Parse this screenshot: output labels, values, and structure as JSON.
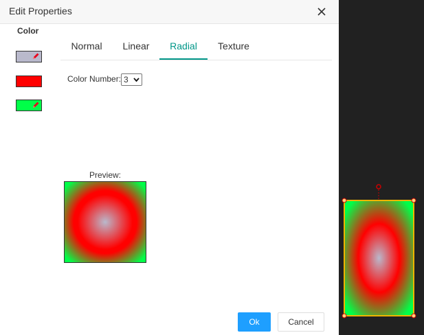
{
  "dialog": {
    "title": "Edit Properties",
    "color_heading": "Color",
    "swatches": [
      {
        "color": "#b9b9cc",
        "editable": true
      },
      {
        "color": "#ff0000",
        "editable": false
      },
      {
        "color": "#00ff48",
        "editable": true
      }
    ],
    "tabs": [
      {
        "label": "Normal",
        "active": false
      },
      {
        "label": "Linear",
        "active": false
      },
      {
        "label": "Radial",
        "active": true
      },
      {
        "label": "Texture",
        "active": false
      }
    ],
    "color_number_label": "Color Number:",
    "color_number_value": "3",
    "preview_label": "Preview:",
    "ok_label": "Ok",
    "cancel_label": "Cancel"
  },
  "gradient": {
    "type": "radial",
    "stops": [
      "#b9b9cc",
      "#ff0000",
      "#00ff48"
    ]
  },
  "colors": {
    "accent": "#009688",
    "primary_button": "#1e9fff",
    "canvas_background": "#212121",
    "selection": "#f0b400",
    "handle": "#cc0000"
  }
}
